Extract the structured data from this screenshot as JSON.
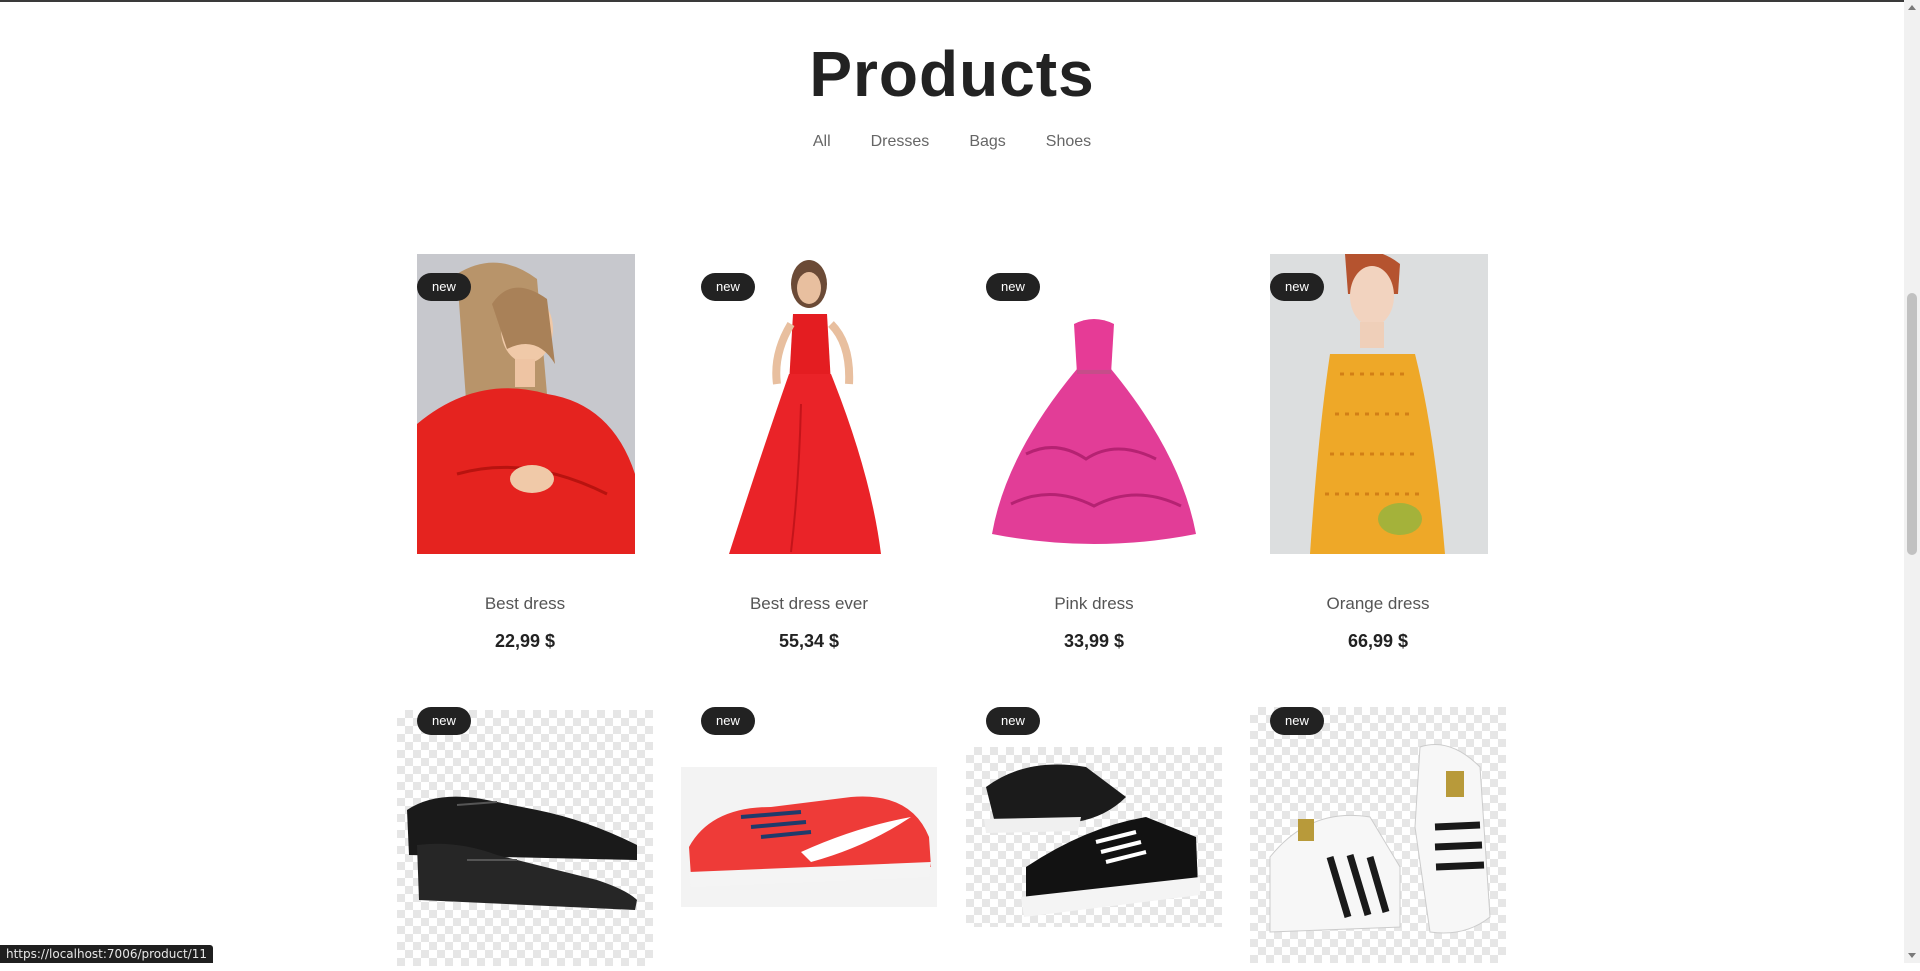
{
  "page": {
    "title": "Products"
  },
  "filters": [
    "All",
    "Dresses",
    "Bags",
    "Shoes"
  ],
  "products": [
    {
      "name": "Best dress",
      "price": "22,99 $",
      "badge": "new",
      "image": "woman-red-sweater"
    },
    {
      "name": "Best dress ever",
      "price": "55,34 $",
      "badge": "new",
      "image": "woman-red-gown"
    },
    {
      "name": "Pink dress",
      "price": "33,99 $",
      "badge": "new",
      "image": "pink-ball-gown"
    },
    {
      "name": "Orange dress",
      "price": "66,99 $",
      "badge": "new",
      "image": "woman-orange-dress"
    },
    {
      "badge": "new",
      "image": "black-leather-shoes"
    },
    {
      "badge": "new",
      "image": "red-running-sneaker"
    },
    {
      "badge": "new",
      "image": "black-white-sneakers"
    },
    {
      "badge": "new",
      "image": "white-striped-sneakers"
    }
  ],
  "status_bar": {
    "url": "https://localhost:7006/product/11"
  },
  "colors": {
    "badge_bg": "#222222",
    "text_dark": "#222222",
    "text_muted": "#666666"
  }
}
